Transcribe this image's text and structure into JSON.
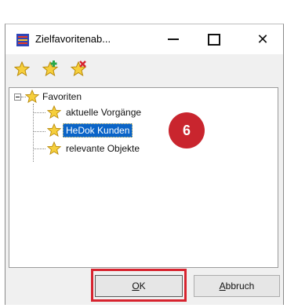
{
  "window": {
    "title": "Zielfavoritenab...",
    "controls": {
      "minimize": "—",
      "maximize": "☐",
      "close": "✕"
    }
  },
  "toolbar": {
    "buttons": [
      {
        "icon": "star-icon"
      },
      {
        "icon": "star-add-icon"
      },
      {
        "icon": "star-remove-icon"
      }
    ]
  },
  "tree": {
    "root": {
      "label": "Favoriten",
      "expander": "minus"
    },
    "children": [
      {
        "label": "aktuelle Vorgänge"
      },
      {
        "label": "HeDok Kunden",
        "selected": true
      },
      {
        "label": "relevante Objekte"
      }
    ]
  },
  "callout": {
    "number": "6",
    "color": "#c9252e"
  },
  "buttons": {
    "ok_label": "OK",
    "cancel_label": "Abbruch"
  },
  "colors": {
    "selection": "#0a64c8",
    "highlight_border": "#d7232e",
    "window_bg": "#f0f0f0"
  }
}
